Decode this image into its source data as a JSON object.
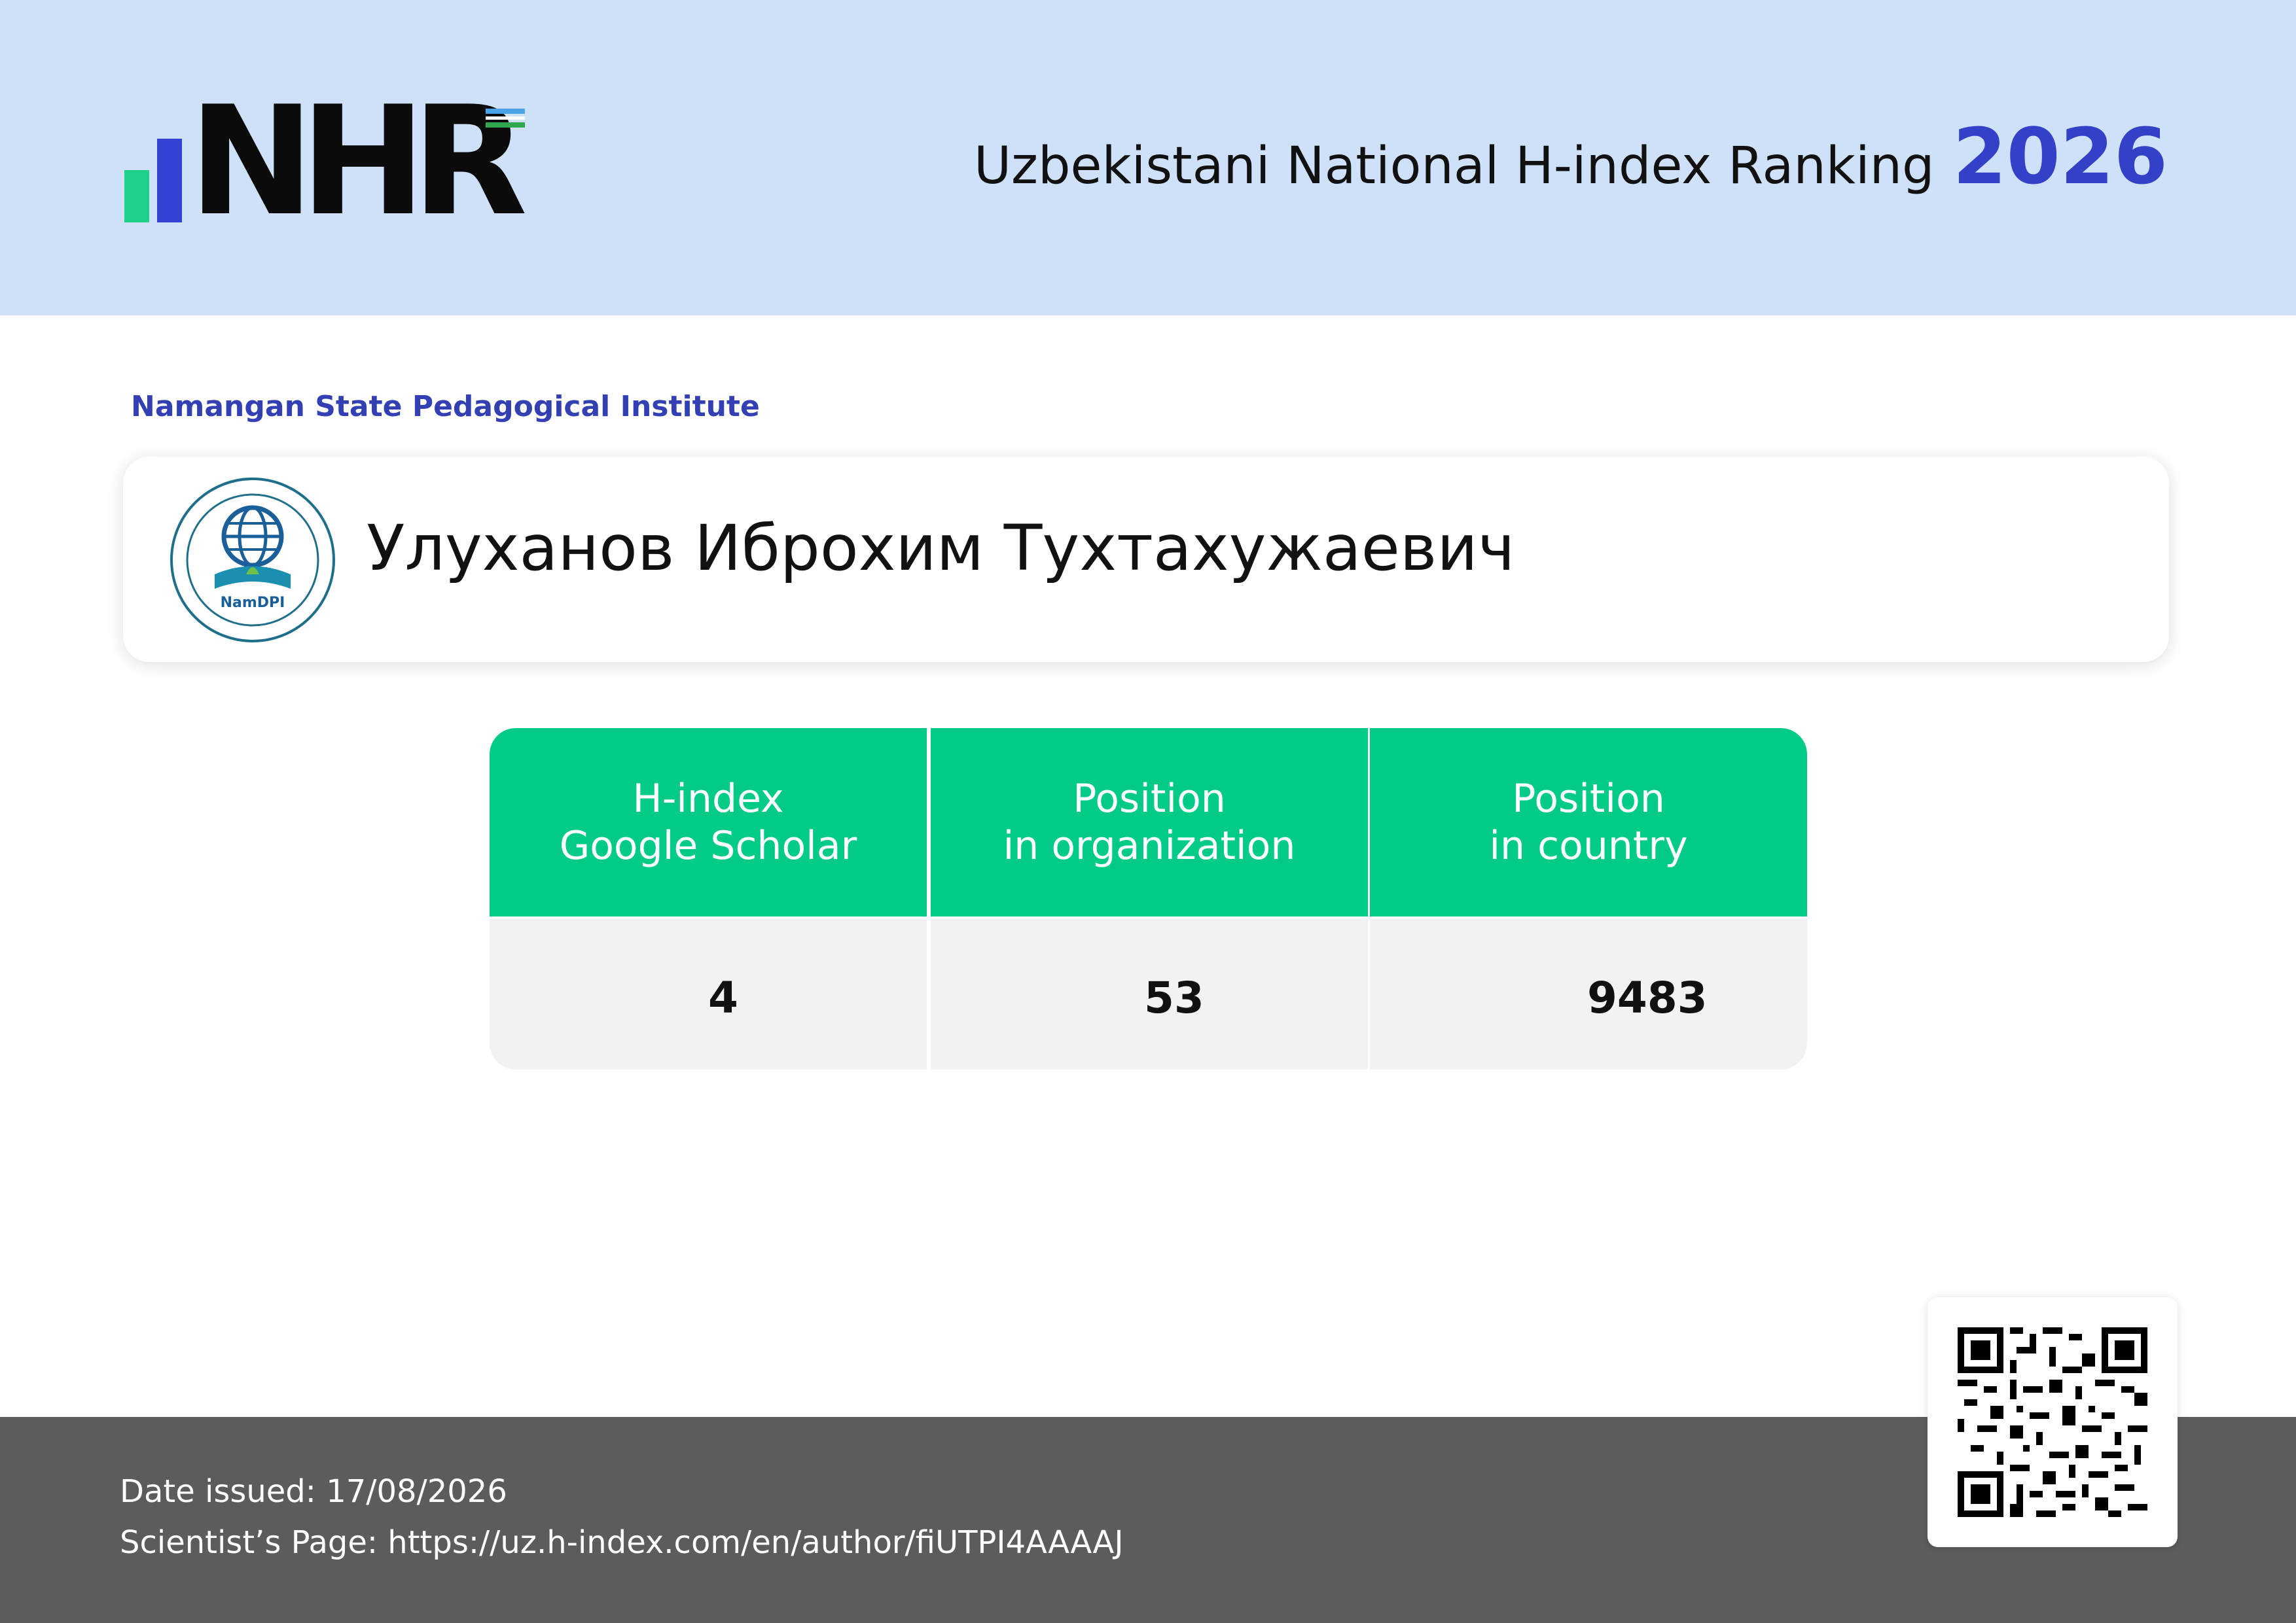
{
  "header": {
    "logo_text": "NHR",
    "title": "Uzbekistani National H-index Ranking",
    "year": "2026",
    "accent_color": "#3340c8",
    "background_color": "#cfe1f8"
  },
  "institution": {
    "name": "Namangan State Pedagogical Institute",
    "logo_text": "NamDPI"
  },
  "scientist": {
    "name": "Улуханов Иброхим Тухтахужаевич"
  },
  "metrics": {
    "header_color": "#01cb86",
    "columns": [
      {
        "label_line1": "H-index",
        "label_line2": "Google Scholar",
        "value": "4"
      },
      {
        "label_line1": "Position",
        "label_line2": "in organization",
        "value": "53"
      },
      {
        "label_line1": "Position",
        "label_line2": "in country",
        "value": "9483"
      }
    ]
  },
  "footer": {
    "date_label": "Date issued:",
    "date_value": "17/08/2026",
    "page_label": "Scientist’s Page:",
    "page_url": "https://uz.h-index.com/en/author/fiUTPI4AAAAJ"
  },
  "qr_code": {
    "icon": "qr-code-icon"
  }
}
